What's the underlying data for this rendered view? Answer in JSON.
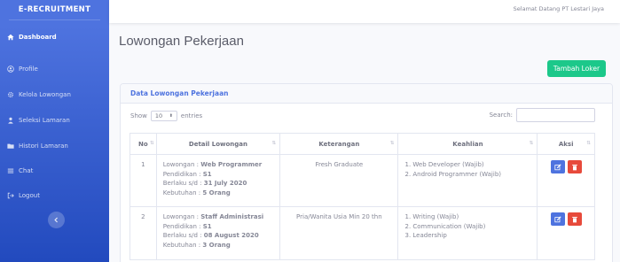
{
  "sidebar": {
    "brand": "E-RECRUITMENT",
    "items": [
      {
        "label": "Dashboard",
        "icon": "home-icon"
      },
      {
        "label": "Profile",
        "icon": "user-circle-icon"
      },
      {
        "label": "Kelola Lowongan",
        "icon": "gear-icon"
      },
      {
        "label": "Seleksi Lamaran",
        "icon": "user-icon"
      },
      {
        "label": "Histori Lamaran",
        "icon": "folder-icon"
      },
      {
        "label": "Chat",
        "icon": "menu-icon"
      },
      {
        "label": "Logout",
        "icon": "logout-icon"
      }
    ]
  },
  "topbar": {
    "welcome": "Selamat Datang PT Lestari Jaya"
  },
  "page": {
    "title": "Lowongan Pekerjaan",
    "add_button": "Tambah Loker"
  },
  "card": {
    "title": "Data Lowongan Pekerjaan",
    "show_label": "Show",
    "entries_value": "10",
    "entries_label": "entries",
    "search_label": "Search:",
    "search_value": ""
  },
  "table": {
    "headers": [
      "No",
      "Detail Lowongan",
      "Keterangan",
      "Keahlian",
      "Aksi"
    ],
    "rows": [
      {
        "no": "1",
        "lowongan_label": "Lowongan : ",
        "lowongan": "Web Programmer",
        "pendidikan_label": "Pendidikan : ",
        "pendidikan": "S1",
        "berlaku_label": "Berlaku s/d : ",
        "berlaku": "31 July 2020",
        "kebutuhan_label": "Kebutuhan : ",
        "kebutuhan": "5 Orang",
        "keterangan": "Fresh Graduate",
        "keahlian": [
          "1. Web Developer (Wajib)",
          "2. Android Programmer (Wajib)"
        ]
      },
      {
        "no": "2",
        "lowongan_label": "Lowongan : ",
        "lowongan": "Staff Administrasi",
        "pendidikan_label": "Pendidikan : ",
        "pendidikan": "S1",
        "berlaku_label": "Berlaku s/d : ",
        "berlaku": "08 August 2020",
        "kebutuhan_label": "Kebutuhan : ",
        "kebutuhan": "3 Orang",
        "keterangan": "Pria/Wanita Usia Min 20 thn",
        "keahlian": [
          "1. Writing (Wajib)",
          "2. Communication (Wajib)",
          "3. Leadership"
        ]
      }
    ]
  },
  "colors": {
    "primary": "#4e73df",
    "success": "#1cc88a",
    "danger": "#e74a3b"
  }
}
